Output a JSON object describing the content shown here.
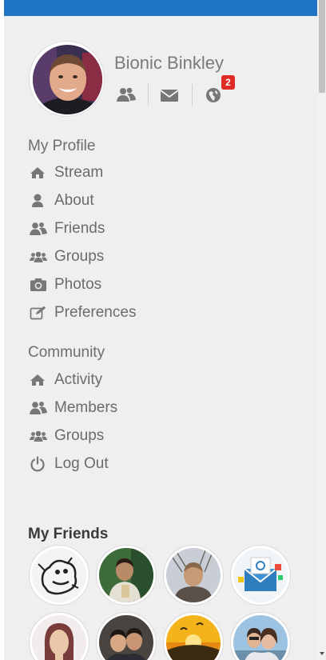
{
  "user": {
    "name": "Bionic Binkley",
    "notification_count": "2"
  },
  "quick_icons": [
    "friends-icon",
    "envelope-icon",
    "globe-icon"
  ],
  "my_profile": {
    "title": "My Profile",
    "items": [
      {
        "label": "Stream",
        "icon": "home-icon"
      },
      {
        "label": "About",
        "icon": "user-icon"
      },
      {
        "label": "Friends",
        "icon": "friends-icon"
      },
      {
        "label": "Groups",
        "icon": "users-group-icon"
      },
      {
        "label": "Photos",
        "icon": "camera-icon"
      },
      {
        "label": "Preferences",
        "icon": "edit-icon"
      }
    ]
  },
  "community": {
    "title": "Community",
    "items": [
      {
        "label": "Activity",
        "icon": "home-icon"
      },
      {
        "label": "Members",
        "icon": "friends-icon"
      },
      {
        "label": "Groups",
        "icon": "users-group-icon"
      },
      {
        "label": "Log Out",
        "icon": "power-icon"
      }
    ]
  },
  "my_friends": {
    "title": "My Friends",
    "count_shown": 8
  },
  "colors": {
    "header_blue": "#1f74c3",
    "sidebar_bg": "#efefef",
    "badge_red": "#e02b27",
    "text_gray": "#6b6b6b"
  }
}
